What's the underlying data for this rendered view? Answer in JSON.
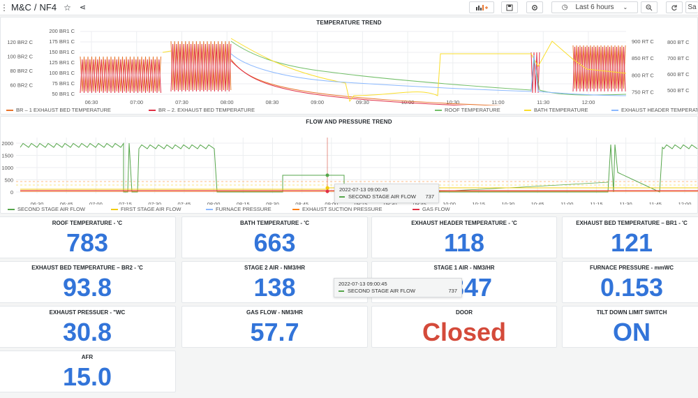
{
  "breadcrumb": {
    "folder": "M&C",
    "separator": "/",
    "dashboard": "NF4"
  },
  "toolbar": {
    "time_range": "Last 6 hours",
    "save_label": "Sa"
  },
  "colors": {
    "green": "#56a64b",
    "yellow": "#f2cc0c",
    "blue": "#8ab8ff",
    "orange": "#ff7f0e",
    "red": "#e02f44",
    "br1": "#e8742c",
    "br2": "#e02f44",
    "roof": "#73bf69",
    "bath": "#fade2a",
    "exhaust_header": "#8ab8ff",
    "stat_blue": "#3274d9",
    "stat_red": "#d44a3a"
  },
  "temperature_panel": {
    "title": "TEMPERATURE TREND",
    "left_axis_outer": [
      "120 BR2 C",
      "100 BR2 C",
      "80 BR2 C",
      "60 BR2 C"
    ],
    "left_axis_inner": [
      "200 BR1 C",
      "175 BR1 C",
      "150 BR1 C",
      "125 BR1 C",
      "100 BR1 C",
      "75 BR1 C",
      "50 BR1 C"
    ],
    "right_axis_inner": [
      "900 RT C",
      "850 RT C",
      "800 RT C",
      "750 RT C"
    ],
    "right_axis_outer": [
      "800 BT C",
      "700 BT C",
      "600 BT C",
      "500 BT C"
    ],
    "x_ticks": [
      "06:30",
      "07:00",
      "07:30",
      "08:00",
      "08:30",
      "09:00",
      "09:30",
      "10:00",
      "10:30",
      "11:00",
      "11:30",
      "12:00"
    ],
    "legend": [
      {
        "label": "BR – 1 EXHAUST BED TEMPERATURE",
        "color": "#e8742c"
      },
      {
        "label": "BR – 2. EXHAUST BED TEMPERATURE",
        "color": "#e02f44"
      },
      {
        "label": "ROOF TEMPERATURE",
        "color": "#73bf69"
      },
      {
        "label": "BATH TEMPERATURE",
        "color": "#fade2a"
      },
      {
        "label": "EXHAUST HEADER TEMPERATURE",
        "color": "#8ab8ff"
      }
    ]
  },
  "flow_panel": {
    "title": "FLOW AND PRESSURE TREND",
    "y_ticks": [
      "2000",
      "1500",
      "1000",
      "500",
      "0"
    ],
    "x_ticks": [
      "06:30",
      "06:45",
      "07:00",
      "07:15",
      "07:30",
      "07:45",
      "08:00",
      "08:15",
      "08:30",
      "08:45",
      "09:00",
      "09:15",
      "09:30",
      "09:45",
      "10:00",
      "10:15",
      "10:30",
      "10:45",
      "11:00",
      "11:15",
      "11:30",
      "11:45",
      "12:00"
    ],
    "legend": [
      {
        "label": "SECOND STAGE AIR FLOW",
        "color": "#56a64b"
      },
      {
        "label": "FIRST STAGE AIR FLOW",
        "color": "#f2cc0c"
      },
      {
        "label": "FURNACE PRESSURE",
        "color": "#8ab8ff"
      },
      {
        "label": "EXHAUST SUCTION PRESSURE",
        "color": "#ff7f0e"
      },
      {
        "label": "GAS FLOW",
        "color": "#e02f44"
      }
    ],
    "tooltip": {
      "time": "2022-07-13 09:00:45",
      "series": "SECOND STAGE AIR FLOW",
      "value": "737"
    }
  },
  "tooltip2": {
    "time": "2022-07-13 09:00:45",
    "series": "SECOND STAGE AIR FLOW",
    "value": "737"
  },
  "stats": [
    {
      "title": "ROOF TEMPERATURE - 'C",
      "value": "783"
    },
    {
      "title": "BATH TEMPERATURE - 'C",
      "value": "663"
    },
    {
      "title": "EXHAUST HEADER TEMPERATURE - 'C",
      "value": "118"
    },
    {
      "title": "EXHAUST BED TEMPERATURE – BR1 - 'C",
      "value": "121"
    },
    {
      "title": "EXHAUST BED TEMPERATURE – BR2 - 'C",
      "value": "93.8"
    },
    {
      "title": "STAGE 2 AIR - NM3/HR",
      "value": "138"
    },
    {
      "title": "STAGE 1 AIR - NM3/HR",
      "value": "2347"
    },
    {
      "title": "FURNACE PRESSURE - mmWC",
      "value": "0.153"
    },
    {
      "title": "EXHAUST PRESSUER - \"WC",
      "value": "30.8"
    },
    {
      "title": "GAS FLOW - NM3/HR",
      "value": "57.7"
    },
    {
      "title": "DOOR",
      "value": "Closed"
    },
    {
      "title": "TILT DOWN LIMIT SWITCH",
      "value": "ON"
    },
    {
      "title": "AFR",
      "value": "15.0"
    }
  ],
  "chart_data": [
    {
      "type": "line",
      "title": "TEMPERATURE TREND",
      "x": [
        "06:30",
        "07:00",
        "07:30",
        "08:00",
        "08:30",
        "09:00",
        "09:30",
        "10:00",
        "10:30",
        "11:00",
        "11:30",
        "12:00"
      ],
      "series": [
        {
          "name": "BR – 1 EXHAUST BED TEMPERATURE",
          "unit": "BR1 C"
        },
        {
          "name": "BR – 2. EXHAUST BED TEMPERATURE",
          "unit": "BR2 C"
        },
        {
          "name": "ROOF TEMPERATURE",
          "unit": "RT C",
          "values": [
            null,
            null,
            null,
            900,
            850,
            820,
            800,
            790,
            780,
            775,
            770,
            775
          ]
        },
        {
          "name": "BATH TEMPERATURE",
          "unit": "BT C",
          "values": [
            null,
            null,
            null,
            800,
            720,
            640,
            560,
            720,
            720,
            700,
            560,
            800
          ]
        },
        {
          "name": "EXHAUST HEADER TEMPERATURE"
        }
      ],
      "y_ranges": {
        "BR1": [
          50,
          200
        ],
        "BR2": [
          60,
          120
        ],
        "RT": [
          750,
          900
        ],
        "BT": [
          500,
          800
        ]
      }
    },
    {
      "type": "line",
      "title": "FLOW AND PRESSURE TREND",
      "x": [
        "06:30",
        "07:00",
        "07:30",
        "08:00",
        "08:30",
        "09:00",
        "09:30",
        "10:00",
        "10:30",
        "11:00",
        "11:30",
        "12:00"
      ],
      "series": [
        {
          "name": "SECOND STAGE AIR FLOW",
          "values": [
            2000,
            1900,
            1900,
            0,
            0,
            737,
            0,
            0,
            0,
            150,
            2000,
            2000
          ]
        },
        {
          "name": "FIRST STAGE AIR FLOW"
        },
        {
          "name": "FURNACE PRESSURE"
        },
        {
          "name": "EXHAUST SUCTION PRESSURE"
        },
        {
          "name": "GAS FLOW"
        }
      ],
      "ylim": [
        0,
        2000
      ]
    }
  ]
}
